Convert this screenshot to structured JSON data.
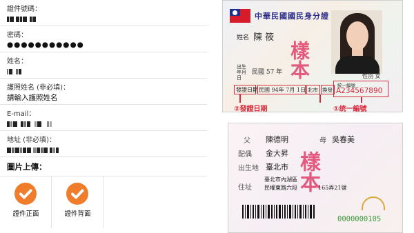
{
  "form": {
    "id_number": {
      "label": "證件號碼：",
      "value": ""
    },
    "password": {
      "label": "密碼：",
      "value": "●●●●●●●●●●●"
    },
    "name": {
      "label": "姓名：",
      "value": ""
    },
    "passport_name": {
      "label": "護照姓名 (非必填)：",
      "placeholder": "請輸入護照姓名"
    },
    "email": {
      "label": "E-mail：",
      "value": ""
    },
    "address": {
      "label": "地址 (非必填)：",
      "value": ""
    },
    "upload": {
      "title": "圖片上傳：",
      "tiles": [
        {
          "label": "證件正面"
        },
        {
          "label": "證件背面"
        }
      ]
    }
  },
  "id_front": {
    "title": "中華民國國民身分證",
    "stamp": "樣本",
    "name_key": "姓名",
    "name_value": "陳 筱",
    "birth_key": "出生年月日",
    "birth_value": "民國 57 年",
    "sex_value": "性別 女",
    "issue_key": "發證日期",
    "issue_value": "民國 94年 7月 1日",
    "issue_place": "北市",
    "issue_type": "換發",
    "id_key": "統一編號",
    "id_value": "A234567890",
    "note_left": "②發證日期",
    "note_right": "①统一編號",
    "colors": {
      "accent": "#d62a3c",
      "title": "#2b2b8a"
    }
  },
  "id_back": {
    "stamp": "樣本",
    "father_key": "父",
    "father_value": "陳德明",
    "mother_key": "母",
    "mother_value": "吳春美",
    "spouse_key": "配偶",
    "spouse_value": "金大昇",
    "birthplace_key": "出生地",
    "birthplace_value": "臺北市",
    "address_key": "住址",
    "address_line1": "臺北市內湖區",
    "address_line2": "民權東路六段",
    "address_line3": "165弄21號",
    "serial": "0000000105"
  },
  "colors": {
    "check_orange": "#ef7d2c",
    "divider": "#e3e3e3"
  }
}
